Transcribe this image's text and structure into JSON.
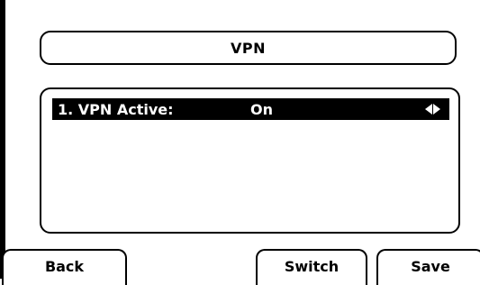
{
  "screen": {
    "title": "VPN"
  },
  "list": {
    "items": [
      {
        "label": "1. VPN Active:",
        "value": "On"
      }
    ]
  },
  "softkeys": {
    "back": "Back",
    "switch": "Switch",
    "save": "Save"
  },
  "icons": {
    "selector": "left-right-arrows-icon"
  },
  "colors": {
    "background": "#ffffff",
    "foreground": "#000000",
    "selection": "#000000",
    "selection_text": "#ffffff"
  }
}
